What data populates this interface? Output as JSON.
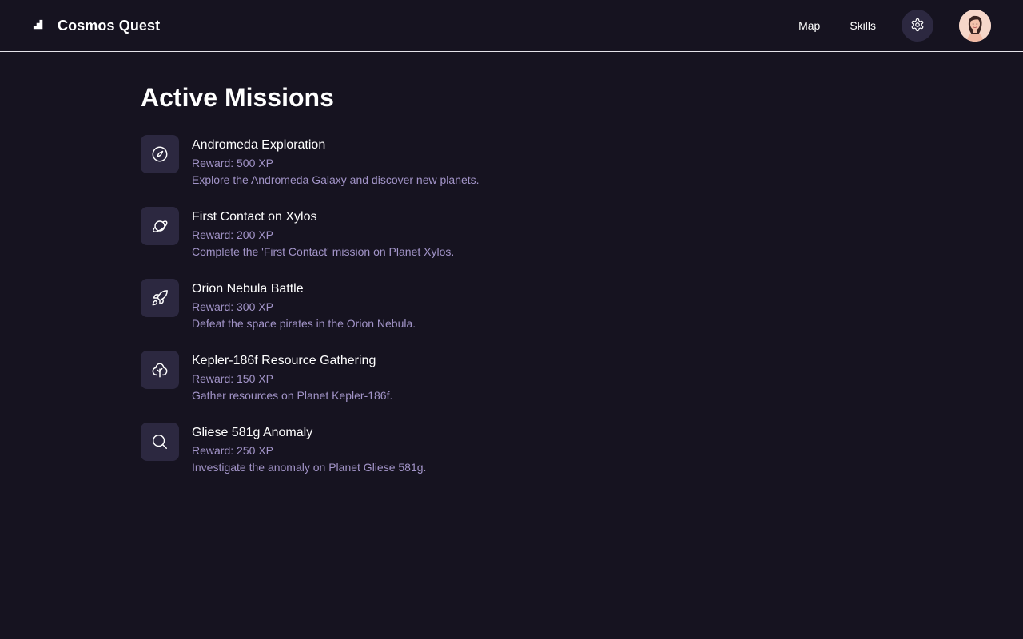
{
  "app": {
    "title": "Cosmos Quest",
    "logo_icon": "bar-steps-icon"
  },
  "nav": {
    "links": [
      "Map",
      "Skills"
    ],
    "settings_icon": "gear-icon",
    "avatar_icon": "user-avatar"
  },
  "colors": {
    "background": "#161320",
    "surface": "#2c2840",
    "muted_text": "#a294c8",
    "text": "#ffffff",
    "divider": "#e5e3ea"
  },
  "main": {
    "title": "Active Missions",
    "missions": [
      {
        "name": "Andromeda Exploration",
        "reward": "Reward: 500 XP",
        "description": "Explore the Andromeda Galaxy and discover new planets.",
        "icon": "compass-icon"
      },
      {
        "name": "First Contact on Xylos",
        "reward": "Reward: 200 XP",
        "description": "Complete the 'First Contact' mission on Planet Xylos.",
        "icon": "planet-icon"
      },
      {
        "name": "Orion Nebula Battle",
        "reward": "Reward: 300 XP",
        "description": "Defeat the space pirates in the Orion Nebula.",
        "icon": "rocket-icon"
      },
      {
        "name": "Kepler-186f Resource Gathering",
        "reward": "Reward: 150 XP",
        "description": "Gather resources on Planet Kepler-186f.",
        "icon": "tree-icon"
      },
      {
        "name": "Gliese 581g Anomaly",
        "reward": "Reward: 250 XP",
        "description": "Investigate the anomaly on Planet Gliese 581g.",
        "icon": "search-icon"
      }
    ]
  }
}
